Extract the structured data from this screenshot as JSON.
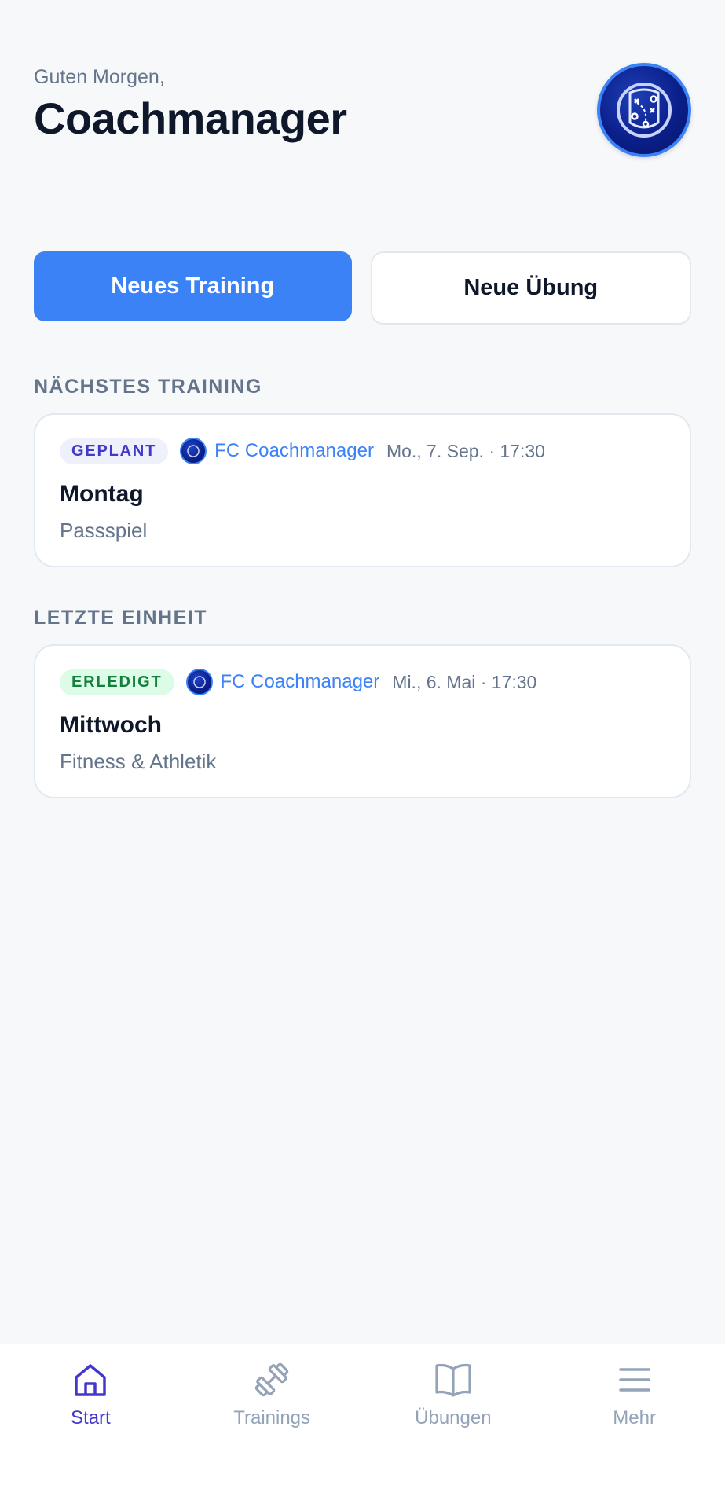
{
  "header": {
    "greeting": "Guten Morgen,",
    "title": "Coachmanager",
    "avatar_icon": "tactics-board-icon"
  },
  "actions": {
    "new_training": "Neues Training",
    "new_exercise": "Neue Übung"
  },
  "next_training": {
    "section_label": "NÄCHSTES TRAINING",
    "status": "GEPLANT",
    "team": "FC Coachmanager",
    "date": "Mo., 7. Sep. · 17:30",
    "title": "Montag",
    "subtitle": "Passspiel"
  },
  "last_session": {
    "section_label": "LETZTE EINHEIT",
    "status": "ERLEDIGT",
    "team": "FC Coachmanager",
    "date": "Mi., 6. Mai · 17:30",
    "title": "Mittwoch",
    "subtitle": "Fitness & Athletik"
  },
  "tabbar": {
    "items": [
      {
        "label": "Start",
        "icon": "home-icon",
        "active": true
      },
      {
        "label": "Trainings",
        "icon": "dumbbell-icon",
        "active": false
      },
      {
        "label": "Übungen",
        "icon": "book-icon",
        "active": false
      },
      {
        "label": "Mehr",
        "icon": "menu-icon",
        "active": false
      }
    ]
  },
  "colors": {
    "accent": "#3b82f6",
    "active_tab": "#4338ca",
    "planned_badge": "#4338ca",
    "done_badge": "#15803d"
  }
}
